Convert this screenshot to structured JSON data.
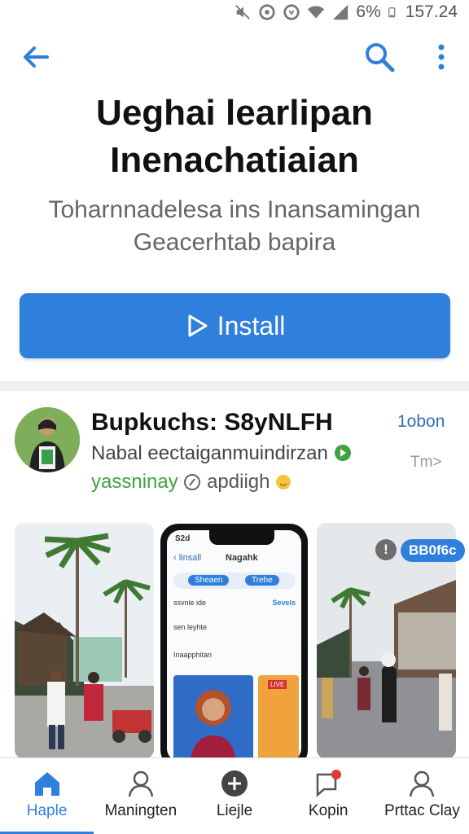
{
  "status": {
    "battery": "6%",
    "time": "157.24"
  },
  "app": {
    "title_line1": "Ueghai learlipan",
    "title_line2": "Inenachatiaian",
    "subtitle_line1": "Toharnnadelesa ins Inansamingan",
    "subtitle_line2": "Geacerhtab bapira",
    "install_label": "Install"
  },
  "profile": {
    "name": "Bupkuchs: S8yNLFH",
    "description": "Nabal eectaiganmuindirzan",
    "tag_green": "yassninay",
    "tag_other": "apdiigh",
    "follow_label": "1obon",
    "more_label": "Tm>"
  },
  "screens": {
    "phone_back": "linsall",
    "phone_title": "Nagahk",
    "phone_chip1": "Sheaen",
    "phone_chip2": "Trehe",
    "rows": [
      {
        "label": "ssvnle ide",
        "action": "Sevels"
      },
      {
        "label": "sen leyhte",
        "action": ""
      },
      {
        "label": "Inaapphitan",
        "action": ""
      }
    ],
    "phone_time": "S2d",
    "live_label": "LIVE",
    "badge_label": "BB0f6c"
  },
  "nav": [
    {
      "label": "Haple",
      "icon": "home-icon",
      "active": true
    },
    {
      "label": "Maningten",
      "icon": "person-icon",
      "active": false
    },
    {
      "label": "Liejle",
      "icon": "add-circle-icon",
      "active": false
    },
    {
      "label": "Kopin",
      "icon": "chat-icon",
      "active": false
    },
    {
      "label": "Prttac Clay",
      "icon": "account-icon",
      "active": false
    }
  ],
  "colors": {
    "accent": "#2f7fdc",
    "green": "#3fa33f"
  }
}
